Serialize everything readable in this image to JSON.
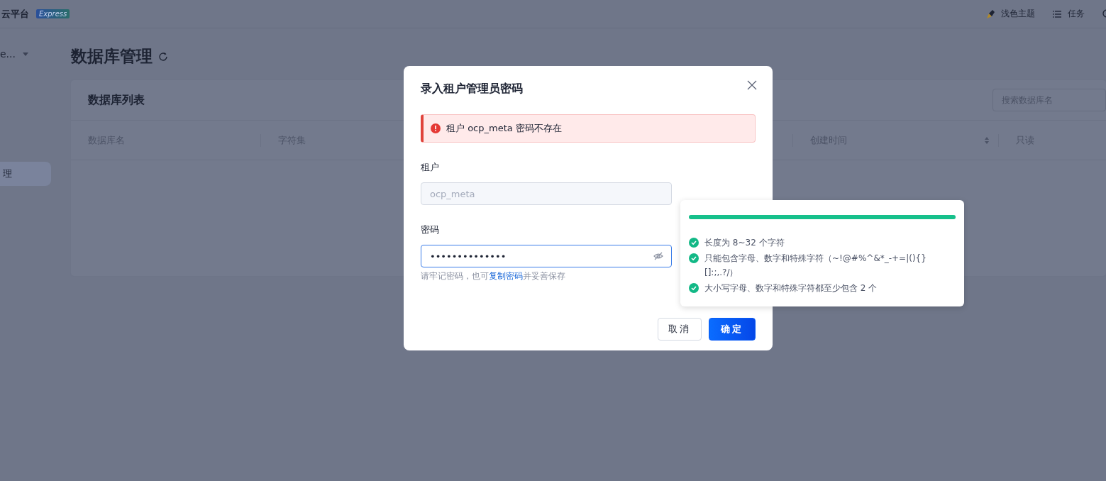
{
  "header": {
    "product": "云平台",
    "badge": "Express",
    "actions": [
      {
        "kind": "theme",
        "label": "浅色主题"
      },
      {
        "kind": "tasks",
        "label": "任务"
      },
      {
        "kind": "help"
      }
    ]
  },
  "sidebar": {
    "switcher": "e...",
    "items": [
      {
        "label": "理",
        "selected": true
      }
    ]
  },
  "page": {
    "title": "数据库管理"
  },
  "card": {
    "title": "数据库列表",
    "search": {
      "placeholder": "搜索数据库名"
    },
    "columns": [
      {
        "label": "数据库名",
        "sortable": false
      },
      {
        "label": "字符集",
        "sortable": false
      },
      {
        "label": "创建时间",
        "sortable": true
      },
      {
        "label": "只读",
        "sortable": false
      }
    ]
  },
  "dialog": {
    "title": "录入租户管理员密码",
    "alert": "租户 ocp_meta 密码不存在",
    "fields": [
      {
        "kind": "text",
        "label": "租户",
        "value": "ocp_meta",
        "disabled": true
      },
      {
        "kind": "password",
        "label": "密码",
        "value": "••••••••••••••",
        "disabled": false,
        "focused": true
      }
    ],
    "hint": "请牢记密码，也可",
    "hint_link": "复制密码",
    "hint_after": "并妥善保存",
    "buttons": [
      {
        "label": "取消",
        "primary": false
      },
      {
        "label": "确定",
        "primary": true
      }
    ]
  },
  "strength": {
    "level": 1,
    "rules": [
      {
        "text": "长度为 8~32 个字符",
        "checked": true
      },
      {
        "text": "只能包含字母、数字和特殊字符（~!@#%^&*_-+=|(){}[]:;,.?/）",
        "checked": true
      },
      {
        "text": "大小写字母、数字和特殊字符都至少包含 2 个",
        "checked": true
      }
    ]
  }
}
